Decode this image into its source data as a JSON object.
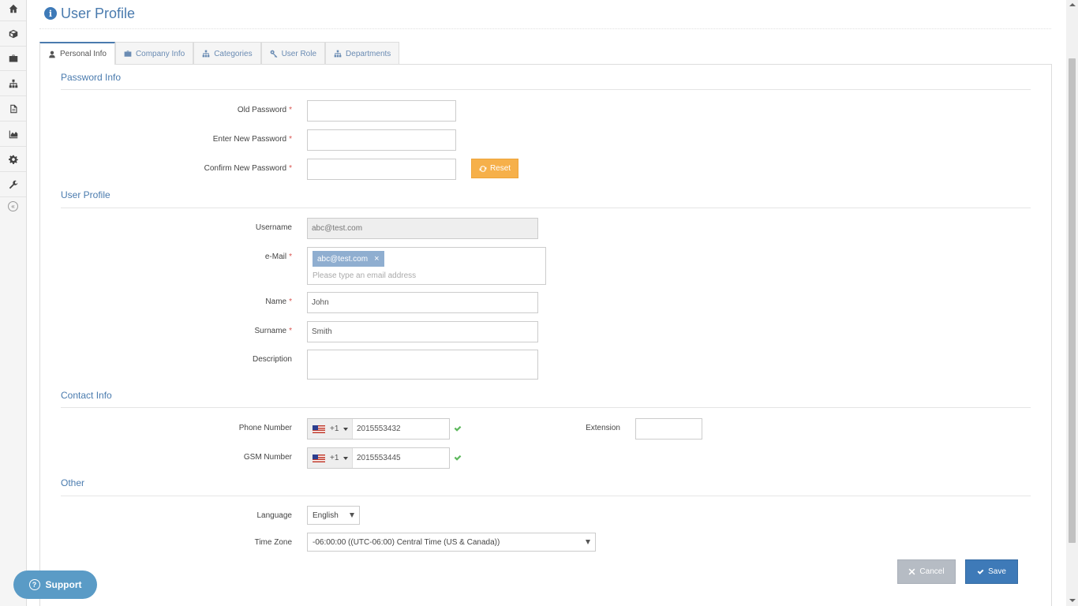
{
  "header": {
    "title": "User Profile",
    "icon": "info-icon"
  },
  "tabs": [
    {
      "label": "Personal Info",
      "icon": "user-icon",
      "active": true
    },
    {
      "label": "Company Info",
      "icon": "briefcase-icon"
    },
    {
      "label": "Categories",
      "icon": "sitemap-icon"
    },
    {
      "label": "User Role",
      "icon": "key-icon"
    },
    {
      "label": "Departments",
      "icon": "sitemap-icon"
    }
  ],
  "sidebar": {
    "items": [
      "home-icon",
      "cube-icon",
      "briefcase-icon",
      "sitemap-icon",
      "document-icon",
      "area-chart-icon",
      "gear-icon",
      "wrench-icon"
    ],
    "collapse": "«"
  },
  "sections": {
    "password": "Password Info",
    "profile": "User Profile",
    "contact": "Contact Info",
    "other": "Other"
  },
  "password": {
    "old_label": "Old Password",
    "new_label": "Enter New Password",
    "confirm_label": "Confirm New Password",
    "required_mark": "*",
    "reset_label": "Reset"
  },
  "profile": {
    "username_label": "Username",
    "username_value": "abc@test.com",
    "email_label": "e-Mail",
    "email_tag": "abc@test.com",
    "email_tag_remove": "×",
    "email_placeholder": "Please type an email address",
    "name_label": "Name",
    "name_value": "John",
    "surname_label": "Surname",
    "surname_value": "Smith",
    "description_label": "Description"
  },
  "contact": {
    "phone_label": "Phone Number",
    "phone_code": "+1",
    "phone_value": "2015553432",
    "gsm_label": "GSM Number",
    "gsm_code": "+1",
    "gsm_value": "2015553445",
    "extension_label": "Extension"
  },
  "other": {
    "language_label": "Language",
    "language_value": "English",
    "timezone_label": "Time Zone",
    "timezone_value": "-06:00:00 ((UTC-06:00) Central Time (US & Canada))"
  },
  "actions": {
    "cancel": "Cancel",
    "save": "Save"
  },
  "support": {
    "label": "Support",
    "glyph": "?"
  },
  "colors": {
    "accent": "#4a7bae",
    "reset": "#f6b04a",
    "save": "#3e7ab8",
    "cancel": "#b6bcc4",
    "required": "#d9534f",
    "valid": "#5cb85c"
  }
}
